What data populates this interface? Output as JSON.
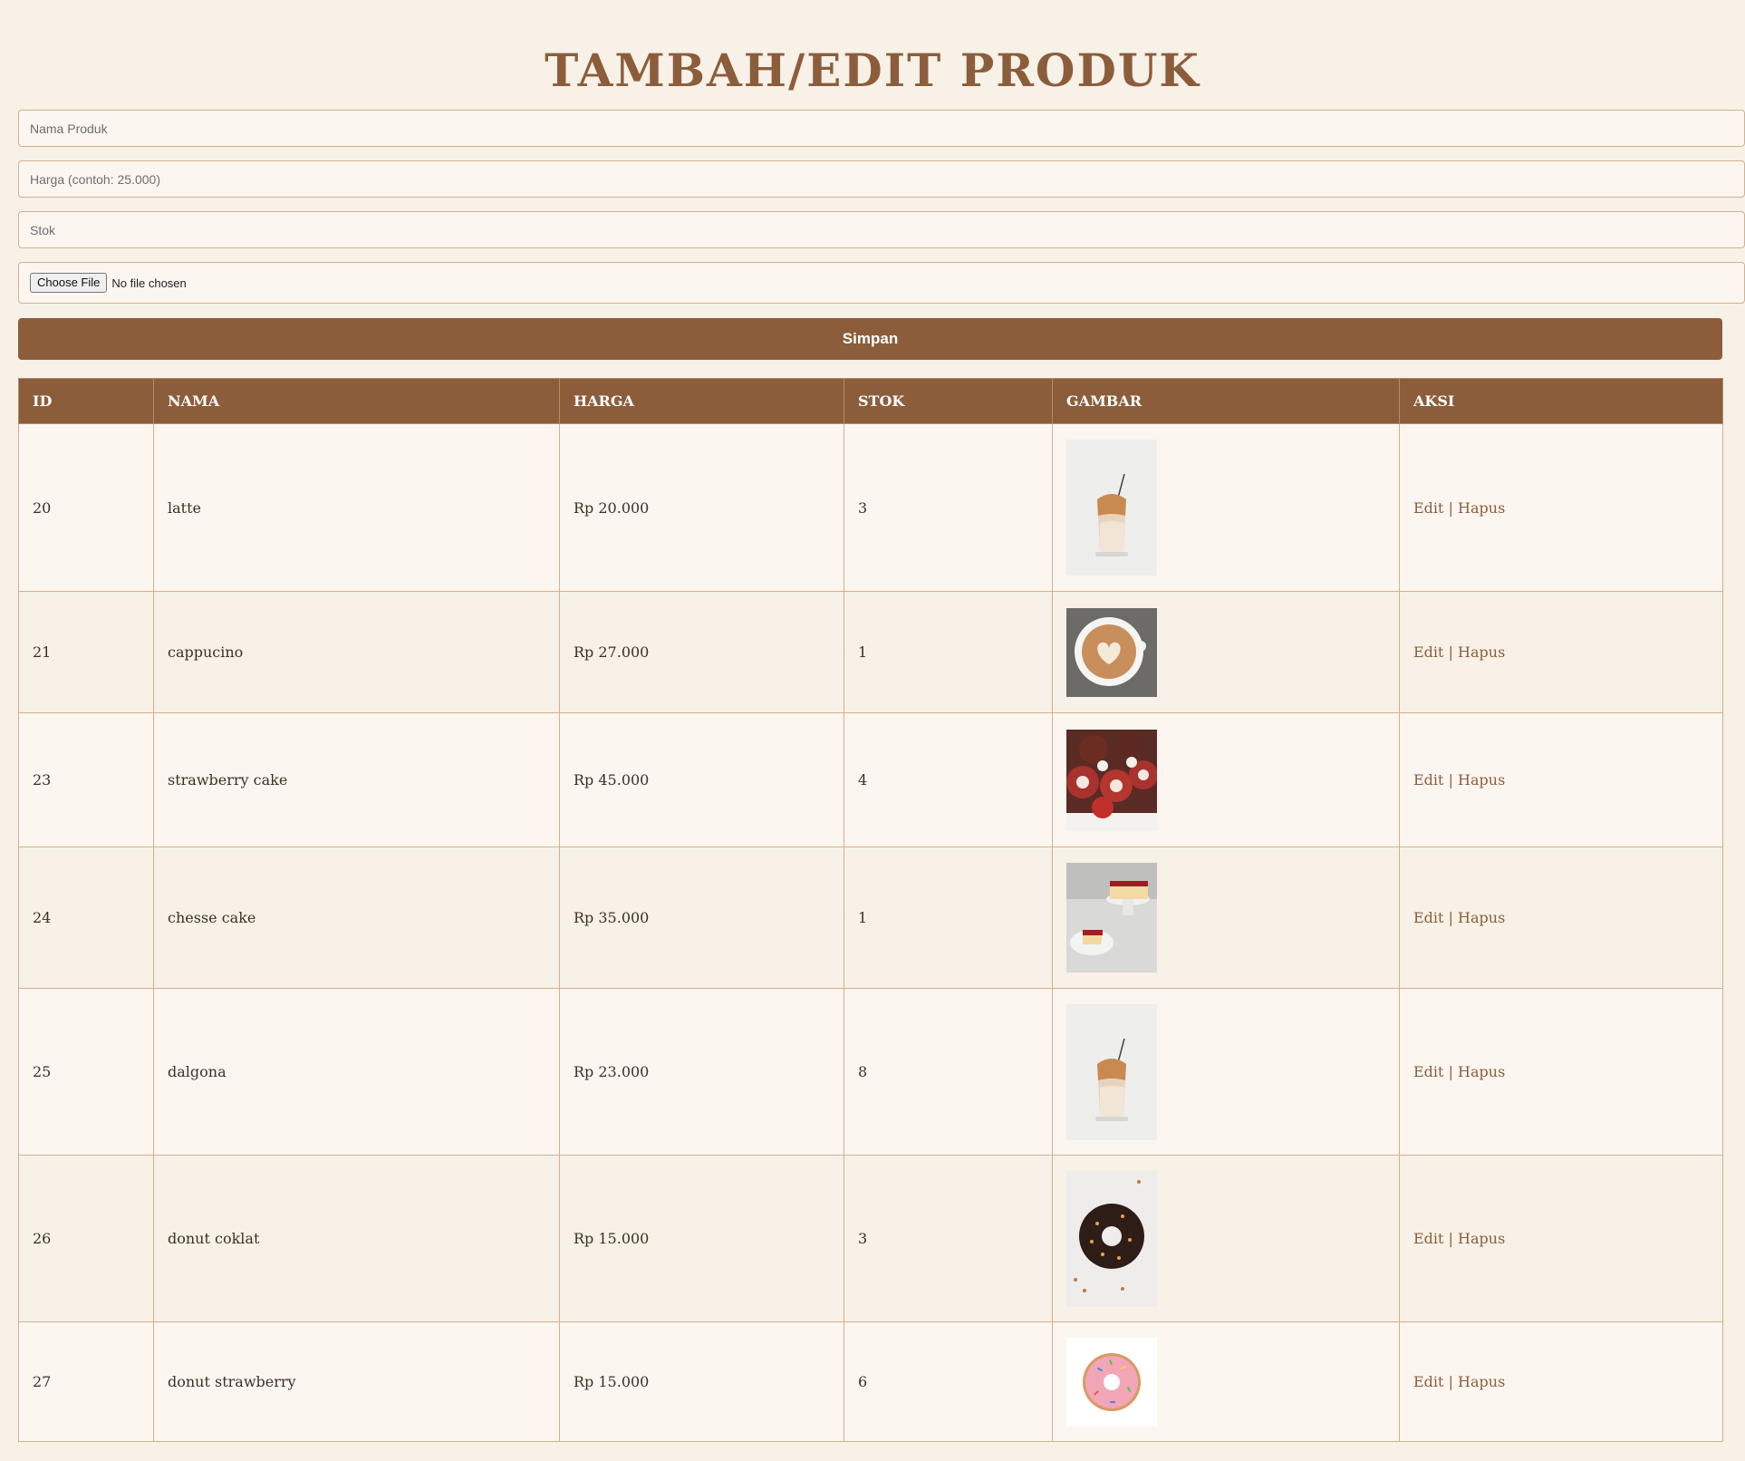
{
  "page": {
    "title": "TAMBAH/EDIT PRODUK"
  },
  "form": {
    "name_placeholder": "Nama Produk",
    "price_placeholder": "Harga (contoh: 25.000)",
    "stock_placeholder": "Stok",
    "file_button": "Choose File",
    "file_status": "No file chosen",
    "save_label": "Simpan"
  },
  "table": {
    "headers": [
      "ID",
      "NAMA",
      "HARGA",
      "STOK",
      "GAMBAR",
      "AKSI"
    ],
    "rows": [
      {
        "id": "20",
        "nama": "latte",
        "harga": "Rp 20.000",
        "stok": "3",
        "image": "iced-latte-glass-photo",
        "edit": "Edit",
        "sep": "|",
        "hapus": "Hapus"
      },
      {
        "id": "21",
        "nama": "cappucino",
        "harga": "Rp 27.000",
        "stok": "1",
        "image": "latte-art-cup-photo",
        "edit": "Edit",
        "sep": "|",
        "hapus": "Hapus"
      },
      {
        "id": "23",
        "nama": "strawberry cake",
        "harga": "Rp 45.000",
        "stok": "4",
        "image": "red-velvet-roll-photo",
        "edit": "Edit",
        "sep": "|",
        "hapus": "Hapus"
      },
      {
        "id": "24",
        "nama": "chesse cake",
        "harga": "Rp 35.000",
        "stok": "1",
        "image": "cheesecake-photo",
        "edit": "Edit",
        "sep": "|",
        "hapus": "Hapus"
      },
      {
        "id": "25",
        "nama": "dalgona",
        "harga": "Rp 23.000",
        "stok": "8",
        "image": "iced-latte-glass-photo",
        "edit": "Edit",
        "sep": "|",
        "hapus": "Hapus"
      },
      {
        "id": "26",
        "nama": "donut coklat",
        "harga": "Rp 15.000",
        "stok": "3",
        "image": "chocolate-donut-photo",
        "edit": "Edit",
        "sep": "|",
        "hapus": "Hapus"
      },
      {
        "id": "27",
        "nama": "donut strawberry",
        "harga": "Rp 15.000",
        "stok": "6",
        "image": "pink-donut-photo",
        "edit": "Edit",
        "sep": "|",
        "hapus": "Hapus"
      }
    ]
  },
  "colors": {
    "brand": "#8c5d3b",
    "background": "#f7f1e7",
    "border": "#d4b08d"
  }
}
